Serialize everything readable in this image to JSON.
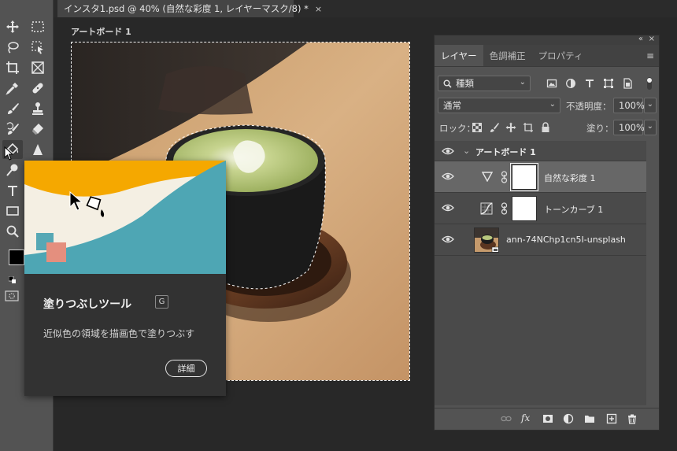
{
  "document": {
    "tab_title": "インスタ1.psd @ 40% (自然な彩度 1, レイヤーマスク/8) *",
    "close_glyph": "×"
  },
  "artboard": {
    "label": "アートボード 1"
  },
  "toolbar": {
    "tools": [
      "move-tool",
      "marquee-tool",
      "lasso-tool",
      "object-select-tool",
      "crop-tool",
      "frame-tool",
      "eyedropper-tool",
      "healing-brush-tool",
      "brush-tool",
      "clone-stamp-tool",
      "history-brush-tool",
      "eraser-tool",
      "paint-bucket-tool",
      "blur-tool",
      "dodge-tool",
      "type-tool",
      "shape-tool",
      "zoom-tool"
    ],
    "foreground_color": "#000000",
    "background_color": "#ffffff"
  },
  "tooltip": {
    "title": "塗りつぶしツール",
    "shortcut": "G",
    "description": "近似色の領域を描画色で塗りつぶす",
    "more_button": "詳細",
    "colors": {
      "yellow": "#f5a800",
      "cream": "#f4efe3",
      "teal": "#4ea6b4",
      "swatch_teal": "#56a8b5",
      "swatch_salmon": "#e48f7e"
    }
  },
  "panel": {
    "collapse_glyph": "«",
    "close_glyph": "×",
    "tabs": [
      {
        "label": "レイヤー",
        "active": true
      },
      {
        "label": "色調補正",
        "active": false
      },
      {
        "label": "プロパティ",
        "active": false
      }
    ],
    "menu_glyph": "≡",
    "filter_kind": "種類",
    "blend_mode": "通常",
    "opacity_label": "不透明度：",
    "opacity_value": "100%",
    "lock_label": "ロック：",
    "fill_label": "塗り：",
    "fill_value": "100%",
    "artboard_group": "アートボード 1",
    "layers": [
      {
        "name": "自然な彩度 1",
        "type": "vibrance-adjustment",
        "selected": true
      },
      {
        "name": "トーンカーブ 1",
        "type": "curves-adjustment",
        "selected": false
      },
      {
        "name": "ann-74NChp1cn5I-unsplash",
        "type": "photo",
        "selected": false
      }
    ],
    "bottom_icons": [
      "link-layers-icon",
      "fx-icon",
      "add-mask-icon",
      "adjustment-layer-icon",
      "new-group-icon",
      "new-layer-icon",
      "trash-icon"
    ],
    "fx_label": "fx"
  }
}
